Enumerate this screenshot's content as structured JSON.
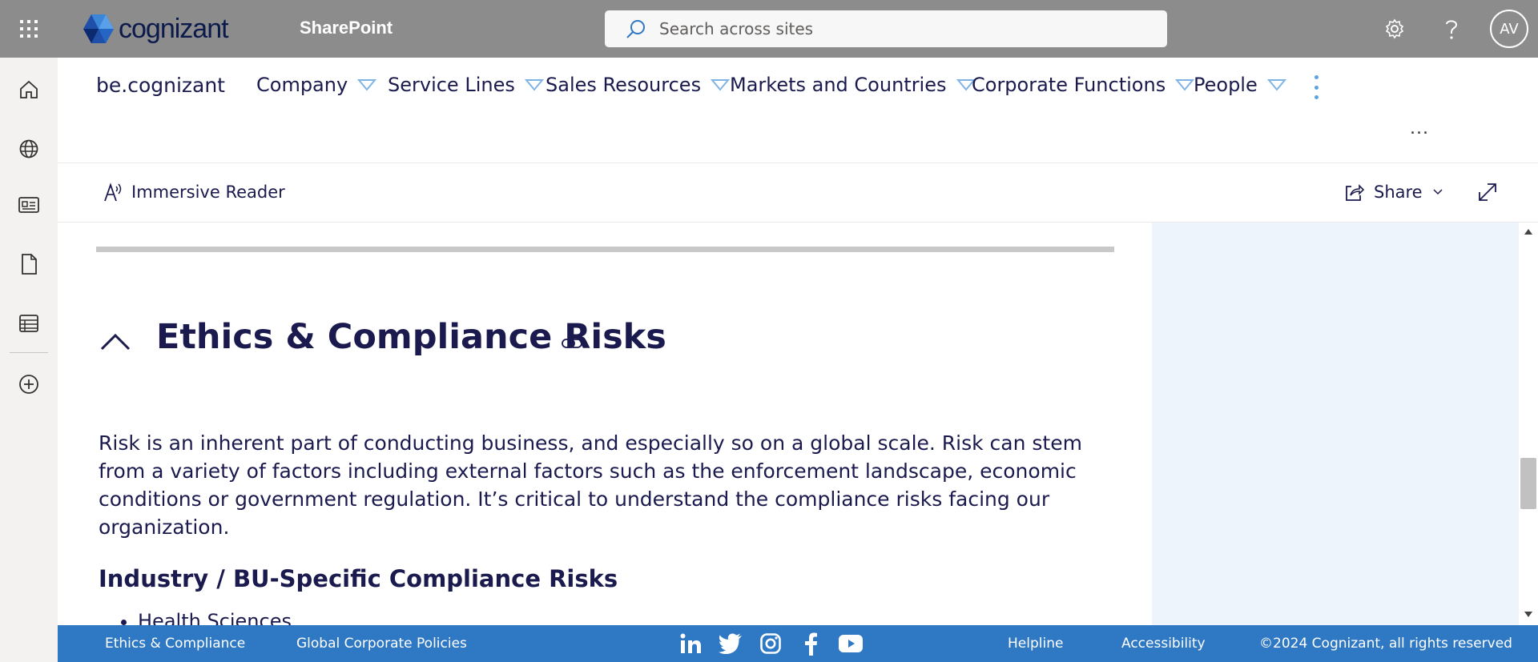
{
  "suite": {
    "brand": "cognizant",
    "product": "SharePoint",
    "search_placeholder": "Search across sites",
    "avatar_initials": "AV"
  },
  "appbar": {
    "items": [
      {
        "name": "home-icon"
      },
      {
        "name": "globe-icon"
      },
      {
        "name": "news-icon"
      },
      {
        "name": "document-icon"
      },
      {
        "name": "list-icon"
      },
      {
        "name": "create-icon"
      }
    ]
  },
  "hubnav": {
    "site_title": "be.cognizant",
    "items": [
      {
        "label": "Company"
      },
      {
        "label": "Service Lines"
      },
      {
        "label": "Sales Resources"
      },
      {
        "label": "Markets and Countries"
      },
      {
        "label": "Corporate Functions"
      },
      {
        "label": "People"
      }
    ],
    "more": "..."
  },
  "command_bar": {
    "immersive_reader": "Immersive Reader",
    "share": "Share"
  },
  "content": {
    "section_title": "Ethics & Compliance Risks",
    "paragraph": "Risk is an inherent part of conducting business, and especially so on a global scale. Risk can stem from a variety of factors including external factors such as the enforcement landscape, economic conditions or government regulation. It’s critical to understand the compliance risks facing our organization.",
    "subheading": "Industry / BU-Specific Compliance Risks",
    "bullets": [
      "Health Sciences"
    ]
  },
  "footer": {
    "left_links": [
      "Ethics & Compliance",
      "Global Corporate Policies"
    ],
    "social": [
      "linkedin-icon",
      "twitter-icon",
      "instagram-icon",
      "facebook-icon",
      "youtube-icon"
    ],
    "right_links": [
      "Helpline",
      "Accessibility"
    ],
    "copyright": "©2024 Cognizant, all rights reserved"
  },
  "colors": {
    "suite_bar": "#8c8c8c",
    "text_navy": "#1b1a4e",
    "footer_blue": "#2f78c4",
    "side_panel": "#eef4fb",
    "nav_triangle": "#7fb3e6"
  }
}
